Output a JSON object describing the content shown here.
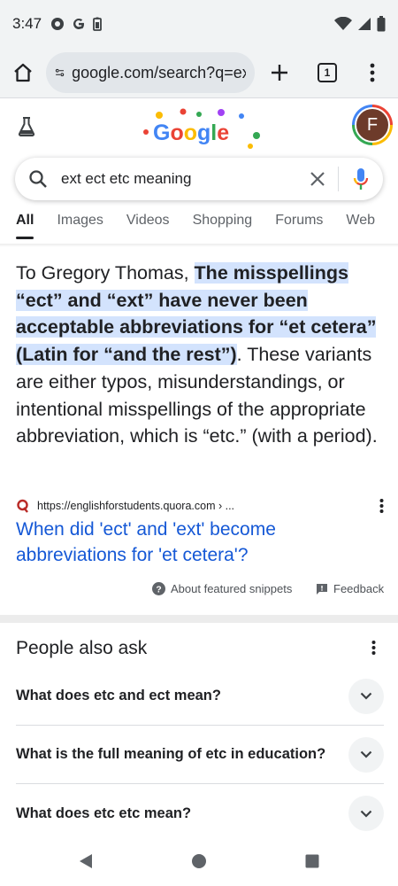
{
  "status_bar": {
    "time": "3:47",
    "left_icons": [
      "chrome-status-icon",
      "google-status-icon",
      "battery-saver-icon"
    ],
    "right_icons": [
      "wifi-icon",
      "signal-icon",
      "battery-icon"
    ]
  },
  "browser": {
    "url": "google.com/search?q=ext+ect+etc+meaning",
    "tab_count": "1"
  },
  "google": {
    "avatar_initial": "F"
  },
  "search": {
    "query": "ext ect etc meaning"
  },
  "tabs": [
    {
      "label": "All",
      "active": true
    },
    {
      "label": "Images"
    },
    {
      "label": "Videos"
    },
    {
      "label": "Shopping"
    },
    {
      "label": "Forums"
    },
    {
      "label": "Web"
    }
  ],
  "snippet": {
    "prefix": "To Gregory Thomas, ",
    "highlight": "The misspellings “ect” and “ext” have never been acceptable abbreviations for “et cetera” (Latin for “and the rest”)",
    "suffix": ". These variants are either typos, misunderstandings, or intentional misspellings of the appropriate abbreviation, which is “etc.” (with a period).",
    "source_url": "https://englishforstudents.quora.com › ...",
    "link_title": "When did 'ect' and 'ext' become abbreviations for 'et cetera'?",
    "about_label": "About featured snippets",
    "feedback_label": "Feedback"
  },
  "people_also_ask": {
    "title": "People also ask",
    "questions": [
      "What does etc and ect mean?",
      "What is the full meaning of etc in education?",
      "What does etc etc mean?"
    ]
  },
  "colors": {
    "highlight": "#d3e3fd",
    "link": "#1558d6",
    "chrome_bg": "#f1f3f4"
  }
}
